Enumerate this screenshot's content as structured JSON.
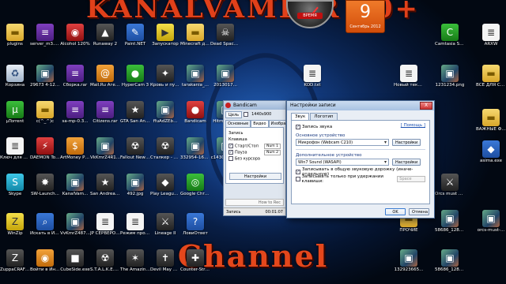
{
  "banner": {
    "top": "KANALVAMPIR 30+",
    "bottom": "Channel"
  },
  "gauge": {
    "label": "ВРЕМЯ"
  },
  "calendar": {
    "day": "9",
    "month": "Сентябрь 2012"
  },
  "icons": [
    {
      "label": "plugins",
      "icon": "folder-icon",
      "glyph": "▬"
    },
    {
      "label": "server_m3.zip",
      "icon": "archive-icon",
      "glyph": "≡"
    },
    {
      "label": "Alcohol 120%",
      "icon": "disc-app-icon",
      "glyph": "◉"
    },
    {
      "label": "Runaway 2",
      "icon": "game-icon",
      "glyph": "▲"
    },
    {
      "label": "Paint.NET",
      "icon": "paint-icon",
      "glyph": "✎"
    },
    {
      "label": "Запускатор",
      "icon": "launcher-icon",
      "glyph": "▶"
    },
    {
      "label": "Minecraft для сервера",
      "icon": "folder-icon",
      "glyph": "▬"
    },
    {
      "label": "Dead Space 2",
      "icon": "game-icon",
      "glyph": "☠"
    },
    {
      "label": "Корзина",
      "icon": "recycle-bin-icon",
      "glyph": "♻"
    },
    {
      "label": "29673 4-128...",
      "icon": "image-icon",
      "glyph": "▣"
    },
    {
      "label": "Сборка.rar",
      "icon": "archive-icon",
      "glyph": "≡"
    },
    {
      "label": "Mail.Ru Агент",
      "icon": "chat-icon",
      "glyph": "@"
    },
    {
      "label": "HyperCam 3",
      "icon": "camera-icon",
      "glyph": "●"
    },
    {
      "label": "Кровь и пули v3.0",
      "icon": "game-icon",
      "glyph": "✦"
    },
    {
      "label": "tarakania_...",
      "icon": "image-icon",
      "glyph": "▣"
    },
    {
      "label": "2013017...",
      "icon": "image-icon",
      "glyph": "▣"
    },
    {
      "label": "µTorrent",
      "icon": "torrent-icon",
      "glyph": "µ"
    },
    {
      "label": "c(^_^)c",
      "icon": "folder-icon",
      "glyph": "▬"
    },
    {
      "label": "sa-mp-0.3...",
      "icon": "archive-icon",
      "glyph": "≡"
    },
    {
      "label": "Citizens.rar",
      "icon": "archive-icon",
      "glyph": "≡"
    },
    {
      "label": "GTA San Andreas",
      "icon": "game-icon",
      "glyph": "★"
    },
    {
      "label": "ffuAdZEb...",
      "icon": "image-icon",
      "glyph": "▣"
    },
    {
      "label": "Bandicam",
      "icon": "bandicam-icon",
      "glyph": "●"
    },
    {
      "label": "Hitman_2...",
      "icon": "image-icon",
      "glyph": "▣"
    },
    {
      "label": "Ключ для офиса.txt",
      "icon": "text-file-icon",
      "glyph": "≣"
    },
    {
      "label": "DAEMON Tools Lite",
      "icon": "disc-app-icon",
      "glyph": "⚡"
    },
    {
      "label": "ArtMoney PRO v7.27",
      "icon": "money-app-icon",
      "glyph": "$"
    },
    {
      "label": "VkKmrZ4R1...",
      "icon": "image-icon",
      "glyph": "▣"
    },
    {
      "label": "Fallout New Vegas",
      "icon": "game-icon",
      "glyph": "☢"
    },
    {
      "label": "Сталкер - Тайные...",
      "icon": "game-icon",
      "glyph": "☢"
    },
    {
      "label": "332954-168...",
      "icon": "image-icon",
      "glyph": "▣"
    },
    {
      "label": "c1430hthhi...",
      "icon": "image-icon",
      "glyph": "▣"
    },
    {
      "label": "Skype",
      "icon": "skype-icon",
      "glyph": "S"
    },
    {
      "label": "SW-Launch...",
      "icon": "game-icon",
      "glyph": "✸"
    },
    {
      "label": "KanalVam...",
      "icon": "image-icon",
      "glyph": "▣"
    },
    {
      "label": "San Andreas Multiplayer",
      "icon": "game-icon",
      "glyph": "★"
    },
    {
      "label": "492.jpg",
      "icon": "image-icon",
      "glyph": "▣"
    },
    {
      "label": "Play League of Legends",
      "icon": "game-icon",
      "glyph": "◆"
    },
    {
      "label": "Google Chrome",
      "icon": "chrome-icon",
      "glyph": "◎"
    },
    {
      "label": "WinZip",
      "icon": "archive-app-icon",
      "glyph": "Z"
    },
    {
      "label": "Искать в Интернете",
      "icon": "search-web-icon",
      "glyph": "⌕"
    },
    {
      "label": "VvKmrZ487...",
      "icon": "image-icon",
      "glyph": "▣"
    },
    {
      "label": "JP СЕРВЕРОВ...",
      "icon": "text-file-icon",
      "glyph": "≣"
    },
    {
      "label": "Режим проверки...",
      "icon": "text-file-icon",
      "glyph": "≣"
    },
    {
      "label": "Lineage II",
      "icon": "game-icon",
      "glyph": "⚔"
    },
    {
      "label": "ЛовиОтвет",
      "icon": "app-icon",
      "glyph": "?"
    },
    {
      "label": "ZuppaCRAFT 1.2.5",
      "icon": "game-icon",
      "glyph": "Z"
    },
    {
      "label": "Войти в Интернет",
      "icon": "internet-icon",
      "glyph": "◉"
    },
    {
      "label": "CubeSide.exe",
      "icon": "game-icon",
      "glyph": "■"
    },
    {
      "label": "S.T.A.L.K.E.R. Зов Припяти",
      "icon": "game-icon",
      "glyph": "☢"
    },
    {
      "label": "The Amazing Spider-Man",
      "icon": "game-icon",
      "glyph": "✶"
    },
    {
      "label": "Devil May Cry 2",
      "icon": "game-icon",
      "glyph": "✝"
    },
    {
      "label": "Counter-Strike 1.6",
      "icon": "game-icon",
      "glyph": "✚"
    },
    {
      "label": "Camtasia Studio 7.1...",
      "icon": "camtasia-icon",
      "glyph": "C"
    },
    {
      "label": "ARXW",
      "icon": "text-file-icon",
      "glyph": "≣"
    },
    {
      "label": "KOD.txt",
      "icon": "text-file-icon",
      "glyph": "≣"
    },
    {
      "label": "Новый текстовый...",
      "icon": "text-file-icon",
      "glyph": "≣"
    },
    {
      "label": "1231234.png",
      "icon": "image-icon",
      "glyph": "▣"
    },
    {
      "label": "ВСЕ ДЛЯ СЕРВЕРА",
      "icon": "folder-icon",
      "glyph": "▬"
    },
    {
      "label": "ВАЖНЫЕ ФАЙЛЫ",
      "icon": "folder-icon",
      "glyph": "▬"
    },
    {
      "label": "asima.exe",
      "icon": "app-icon",
      "glyph": "◆"
    },
    {
      "label": "Orcs must die - Бет...",
      "icon": "game-icon",
      "glyph": "⚔"
    },
    {
      "label": "58686_1280...",
      "icon": "image-icon",
      "glyph": "▣"
    },
    {
      "label": "58686_1280...",
      "icon": "image-icon",
      "glyph": "▣"
    },
    {
      "label": "ПРОЧИЕ",
      "icon": "folder-icon",
      "glyph": "▬"
    },
    {
      "label": "orcs-must-...",
      "icon": "image-icon",
      "glyph": "▣"
    },
    {
      "label": "132923665...",
      "icon": "image-icon",
      "glyph": "▣"
    }
  ],
  "bandicam": {
    "title": "Bandicam",
    "target_btn": "Цель",
    "resolution": "1440x900",
    "tabs": [
      "Основные",
      "Видео",
      "Изображение"
    ],
    "section": "Запись",
    "hotkey_label": "Клавиша",
    "start_stop": "Старт/Стоп",
    "start_key": "Num 1",
    "pause": "Пауза",
    "pause_key": "Num 2",
    "no_cursor": "Без курсора",
    "settings_btn": "Настройки",
    "how_to": "How to Rec",
    "status": "Запись",
    "time": "00:01:07"
  },
  "dialog": {
    "title": "Настройки записи",
    "close": "X",
    "tabs": [
      "Звук",
      "Логотип"
    ],
    "record_sound": "Запись звука",
    "help": "[ Помощь ]",
    "primary_label": "Основное устройство",
    "primary_value": "Микрофон (Webcam C210)",
    "primary_btn": "Настройки",
    "secondary_label": "Дополнительное устройство",
    "secondary_value": "Win7 Sound (WASAPI)",
    "secondary_btn": "Настройки",
    "mix_label": "Записывать в общую звуковую дорожку (иначе-отдельную)",
    "hold_label": "Записывать только при удержании клавиши:",
    "hold_key": "Space",
    "ok": "OK",
    "cancel": "Отмена"
  }
}
